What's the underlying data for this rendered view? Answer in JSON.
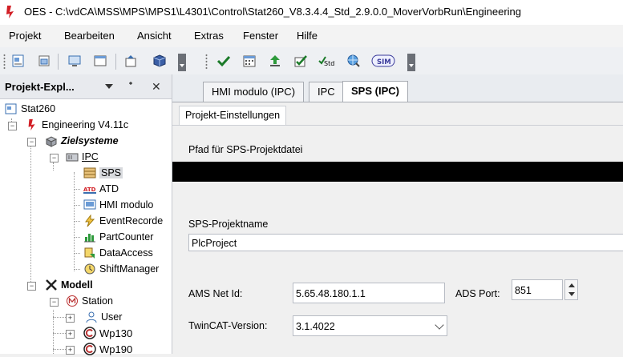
{
  "window": {
    "title": "OES - C:\\vdCA\\MSS\\MPS\\MPS1\\L4301\\Control\\Stat260_V8.3.4.4_Std_2.9.0.0_MoverVorbRun\\Engineering",
    "accent": "#d21f26"
  },
  "menu": [
    "Projekt",
    "Bearbeiten",
    "Ansicht",
    "Extras",
    "Fenster",
    "Hilfe"
  ],
  "toolbar": {
    "buttons": [
      "project-icon",
      "project-props-icon",
      "monitor-icon",
      "window-icon",
      "publish-icon",
      "cube-icon",
      "check-icon",
      "calendar-icon",
      "upload-icon",
      "checkbox-icon",
      "std-icon",
      "globe-search-icon",
      "sim-icon"
    ],
    "sim_label": "SIM",
    "std_label": "Std"
  },
  "explorer": {
    "title": "Projekt-Expl...",
    "pin_glyph": "ᐩ",
    "close_glyph": "✕",
    "tree": {
      "root": "Stat260",
      "engineering": "Engineering V4.11c",
      "zielsysteme": "Zielsysteme",
      "ipc": "IPC",
      "sps": "SPS",
      "atd": "ATD",
      "atd_icon_text": "ATD",
      "hmi": "HMI modulo",
      "event": "EventRecorde",
      "partcounter": "PartCounter",
      "dataaccess": "DataAccess",
      "shiftmanager": "ShiftManager",
      "modell": "Modell",
      "station": "Station",
      "user": "User",
      "wp130": "Wp130",
      "wp190": "Wp190"
    }
  },
  "tabs": {
    "hmi": "HMI modulo (IPC)",
    "ipc": "IPC",
    "sps": "SPS (IPC)"
  },
  "subtab": "Projekt-Einstellungen",
  "form": {
    "pfad_label": "Pfad für SPS-Projektdatei",
    "projektname_label": "SPS-Projektname",
    "projektname_value": "PlcProject",
    "ams_label": "AMS Net Id:",
    "ams_value": "5.65.48.180.1.1",
    "ads_label": "ADS Port:",
    "ads_value": "851",
    "twincat_label": "TwinCAT-Version:",
    "twincat_value": "3.1.4022"
  }
}
